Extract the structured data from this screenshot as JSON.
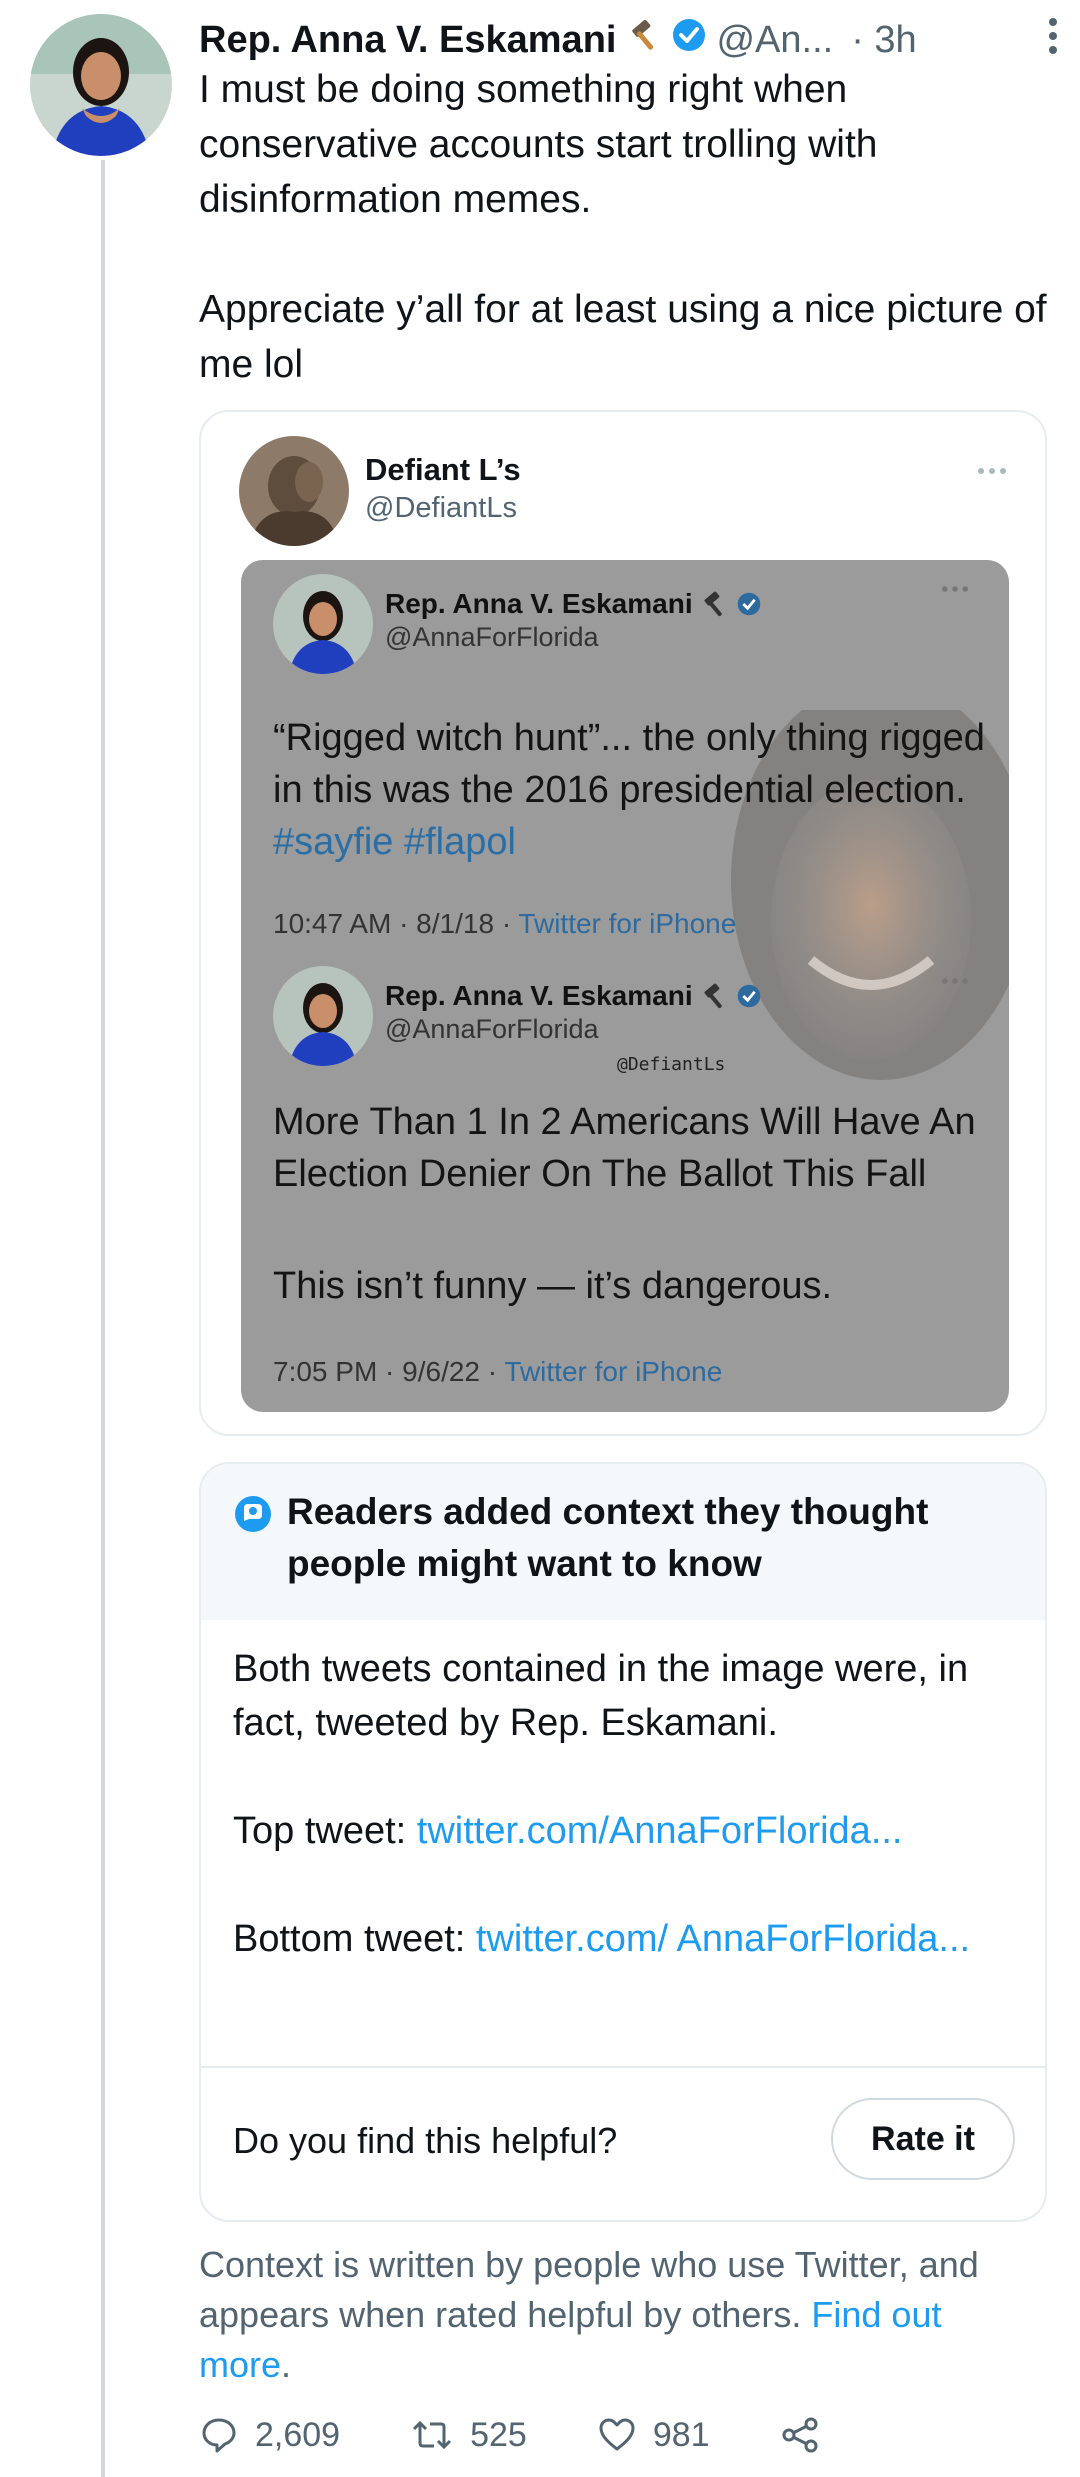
{
  "author": {
    "name": "Rep. Anna V. Eskamani",
    "handle": "@An...",
    "time": "· 3h"
  },
  "tweet": {
    "text": "I must be doing something right when conservative accounts start trolling with disinformation memes.\n\nAppreciate y’all for at least using a nice picture of me lol"
  },
  "quote": {
    "name": "Defiant L’s",
    "handle": "@DefiantLs",
    "image": {
      "top_tweet": {
        "name": "Rep. Anna V. Eskamani",
        "handle": "@AnnaForFlorida",
        "text_part1": "“Rigged witch hunt”... the only thing rigged in this was the 2016  presidential election. ",
        "hashtags": "#sayfie #flapol",
        "date": "10:47 AM · 8/1/18 · ",
        "source": "Twitter for iPhone"
      },
      "bottom_tweet": {
        "name": "Rep. Anna V. Eskamani",
        "handle": "@AnnaForFlorida",
        "text1": "More Than 1 In 2 Americans Will Have An Election Denier On The Ballot This Fall",
        "text2": "This isn’t funny — it’s dangerous.",
        "date": "7:05 PM · 9/6/22 · ",
        "source": "Twitter for iPhone"
      },
      "watermark": "@DefiantLs"
    }
  },
  "community_note": {
    "title": "Readers added context they thought people might want to know",
    "body1": "Both tweets contained in the image were, in fact, tweeted by Rep. Eskamani.",
    "top_label": "Top tweet: ",
    "top_link": "twitter.com/AnnaForFlorida...",
    "bottom_label": "Bottom tweet: ",
    "bottom_link": "twitter.com/ AnnaForFlorida...",
    "question": "Do you find this helpful?",
    "rate_button": "Rate it"
  },
  "context_footer": {
    "text": "Context is written by people who use Twitter, and appears when rated helpful by others. ",
    "link": "Find out more",
    "period": "."
  },
  "actions": {
    "replies": "2,609",
    "retweets": "525",
    "likes": "981"
  },
  "colors": {
    "link": "#1d9bf0",
    "verified": "#1d9bf0",
    "secondary_text": "#536471"
  },
  "icons": [
    "hammer-icon",
    "verified-icon",
    "more-icon",
    "note-icon",
    "reply-icon",
    "retweet-icon",
    "like-icon",
    "share-icon"
  ]
}
